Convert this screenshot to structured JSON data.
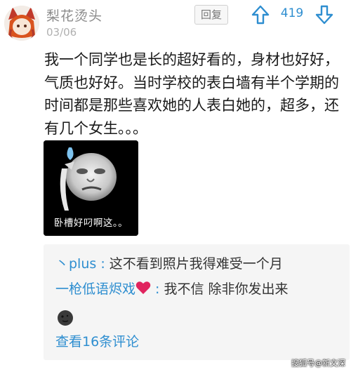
{
  "post": {
    "username": "梨花烫头",
    "date": "03/06",
    "reply_label": "回复",
    "votes": "419",
    "content": "我一个同学也是长的超好看的，身材也好好，气质也好好。当时学校的表白墙有半个学期的时间都是那些喜欢她的人表白她的，超多，还有几个女生。。。",
    "meme_caption": "卧槽好叼啊这。。"
  },
  "comments": [
    {
      "user": "丶plus",
      "separator": " : ",
      "text": "这不看到照片我得难受一个月"
    },
    {
      "user": "一枪低语烬戏",
      "separator": " : ",
      "text": "我不信 除非你发出来"
    }
  ],
  "view_more": "查看16条评论",
  "watermark": "搜狐号@新文深",
  "icons": {
    "upvote": "arrow-up-icon",
    "downvote": "arrow-down-icon",
    "heart": "red-heart-icon",
    "emoji": "moon-face-icon"
  },
  "colors": {
    "accent": "#2e8ed0",
    "muted": "#8a8a8a",
    "comment_bg": "#f5f5f5",
    "heart": "#e0245e"
  }
}
